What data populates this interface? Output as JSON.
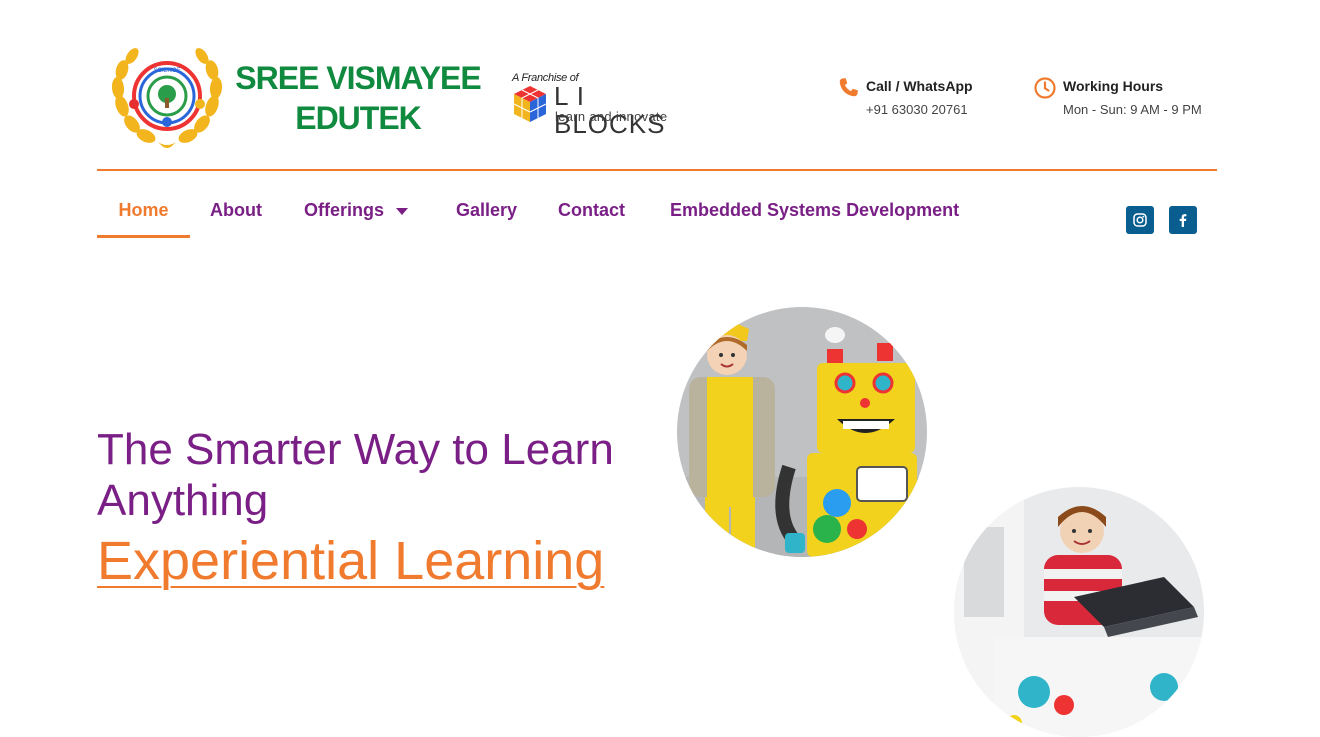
{
  "brand": {
    "name_line1": "SREE VISMAYEE",
    "name_line2": "EDUTEK",
    "emblem_text": "SCIENCE"
  },
  "franchise": {
    "prefix": "A Franchise of",
    "name": "L I BLOCKS",
    "tagline": "learn and innovate"
  },
  "contact": {
    "call": {
      "label": "Call / WhatsApp",
      "value": "+91 63030 20761",
      "icon": "phone-icon"
    },
    "hours": {
      "label": "Working Hours",
      "value": "Mon - Sun: 9 AM - 9 PM",
      "icon": "clock-icon"
    }
  },
  "nav": {
    "items": [
      {
        "label": "Home",
        "active": true
      },
      {
        "label": "About"
      },
      {
        "label": "Offerings",
        "has_dropdown": true
      },
      {
        "label": "Gallery"
      },
      {
        "label": "Contact"
      },
      {
        "label": "Embedded Systems Development"
      }
    ]
  },
  "social": [
    "instagram-icon",
    "facebook-icon"
  ],
  "hero": {
    "title": "The Smarter Way to Learn Anything",
    "subtitle": "Experiential Learning"
  },
  "colors": {
    "accent": "#f07a2e",
    "primary": "#7a1f86",
    "brand_green": "#0f8a3e",
    "social_bg": "#0a5e8f"
  }
}
